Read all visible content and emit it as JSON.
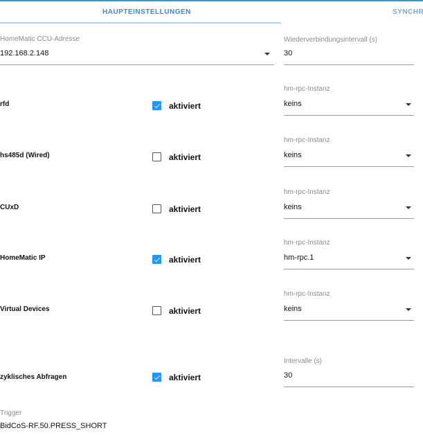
{
  "tabs": [
    {
      "label": "HAUPTEINSTELLUNGEN",
      "active": true
    },
    {
      "label": "SYNCHRO"
    }
  ],
  "ccu": {
    "label": "HomeMatic CCU-Adresse",
    "value": "192.168.2.148"
  },
  "reconnect": {
    "label": "Wiederverbindungsintervall (s)",
    "value": "30"
  },
  "checkbox_label": "aktiviert",
  "rows": [
    {
      "label": "rfd",
      "checked": true,
      "instance_label": "hm-rpc-Instanz",
      "instance": "keins"
    },
    {
      "label": "hs485d (Wired)",
      "checked": false,
      "instance_label": "hm-rpc-Instanz",
      "instance": "keins"
    },
    {
      "label": "CUxD",
      "checked": false,
      "instance_label": "hm-rpc-Instanz",
      "instance": "keins"
    },
    {
      "label": "HomeMatic IP",
      "checked": true,
      "instance_label": "hm-rpc-Instanz",
      "instance": "hm-rpc.1"
    },
    {
      "label": "Virtual Devices",
      "checked": false,
      "instance_label": "hm-rpc-Instanz",
      "instance": "keins"
    }
  ],
  "polling": {
    "label": "zyklisches Abfragen",
    "checked": true,
    "interval_label": "Intervalle (s)",
    "interval": "30"
  },
  "trigger": {
    "label": "Trigger",
    "value": "BidCoS-RF.50.PRESS_SHORT"
  },
  "colors": {
    "accent": "#2196f3",
    "topbar": "#3399cc"
  }
}
